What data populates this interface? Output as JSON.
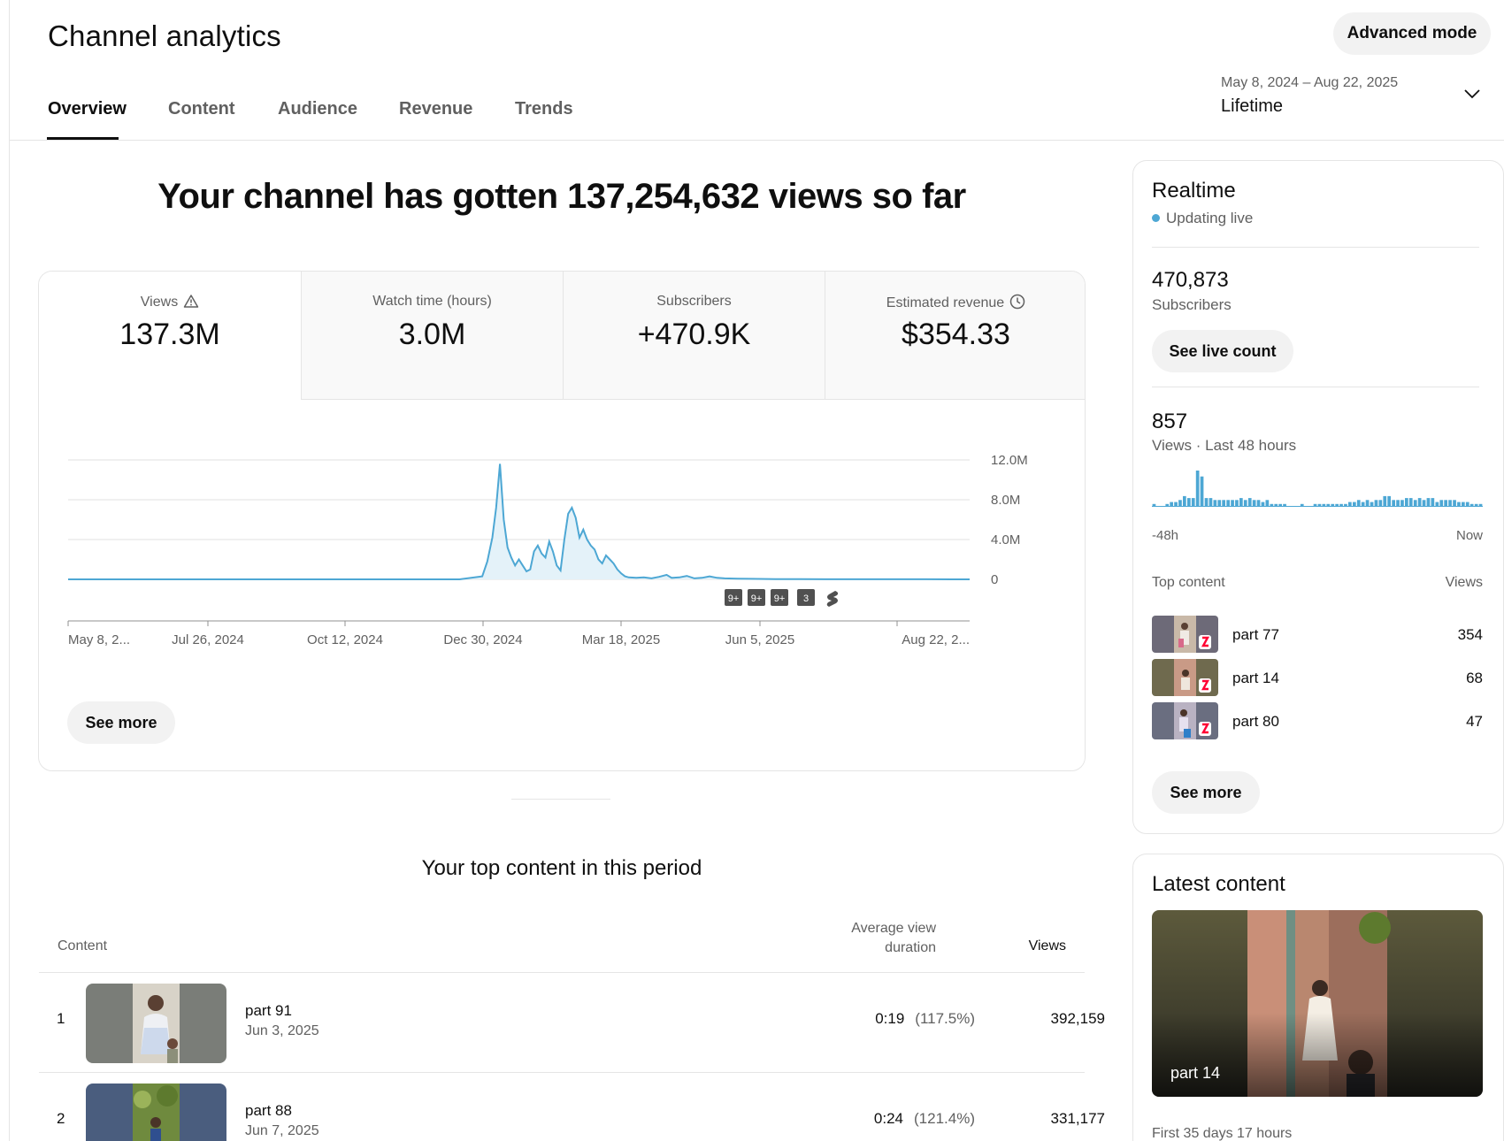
{
  "header": {
    "title": "Channel analytics",
    "advanced_mode_label": "Advanced mode"
  },
  "tabs": [
    {
      "label": "Overview",
      "active": true
    },
    {
      "label": "Content",
      "active": false
    },
    {
      "label": "Audience",
      "active": false
    },
    {
      "label": "Revenue",
      "active": false
    },
    {
      "label": "Trends",
      "active": false
    }
  ],
  "date_range": {
    "dates": "May 8, 2024 – Aug 22, 2025",
    "label": "Lifetime",
    "icon": "chevron-down-icon"
  },
  "headline": "Your channel has gotten 137,254,632 views so far",
  "metrics": [
    {
      "label": "Views",
      "value": "137.3M",
      "icon": "warning-icon",
      "active": true
    },
    {
      "label": "Watch time (hours)",
      "value": "3.0M",
      "active": false
    },
    {
      "label": "Subscribers",
      "value": "+470.9K",
      "active": false
    },
    {
      "label": "Estimated revenue",
      "value": "$354.33",
      "icon": "clock-icon",
      "active": false
    }
  ],
  "chart_data": {
    "type": "area",
    "series": [
      {
        "values": [
          [
            0,
            0
          ],
          [
            310,
            0
          ],
          [
            328,
            0.3
          ],
          [
            332,
            1.8
          ],
          [
            336,
            4.2
          ],
          [
            339,
            7.2
          ],
          [
            342,
            11.6
          ],
          [
            345,
            6.0
          ],
          [
            348,
            3.2
          ],
          [
            351,
            2.2
          ],
          [
            354,
            1.4
          ],
          [
            357,
            2.0
          ],
          [
            360,
            1.4
          ],
          [
            363,
            0.8
          ],
          [
            366,
            1.0
          ],
          [
            369,
            2.8
          ],
          [
            372,
            3.4
          ],
          [
            375,
            2.6
          ],
          [
            378,
            2.2
          ],
          [
            381,
            3.8
          ],
          [
            384,
            2.8
          ],
          [
            387,
            1.4
          ],
          [
            390,
            0.9
          ],
          [
            393,
            4.0
          ],
          [
            396,
            6.6
          ],
          [
            399,
            7.2
          ],
          [
            402,
            6.2
          ],
          [
            405,
            4.2
          ],
          [
            408,
            5.0
          ],
          [
            411,
            4.0
          ],
          [
            414,
            3.4
          ],
          [
            417,
            3.0
          ],
          [
            420,
            2.0
          ],
          [
            423,
            1.6
          ],
          [
            426,
            2.4
          ],
          [
            429,
            2.0
          ],
          [
            432,
            1.6
          ],
          [
            435,
            1.0
          ],
          [
            438,
            0.6
          ],
          [
            441,
            0.3
          ],
          [
            444,
            0.2
          ],
          [
            450,
            0.15
          ],
          [
            456,
            0.2
          ],
          [
            462,
            0.1
          ],
          [
            468,
            0.25
          ],
          [
            474,
            0.45
          ],
          [
            478,
            0.15
          ],
          [
            484,
            0.2
          ],
          [
            490,
            0.35
          ],
          [
            496,
            0.1
          ],
          [
            502,
            0.15
          ],
          [
            508,
            0.3
          ],
          [
            514,
            0.15
          ],
          [
            520,
            0.1
          ],
          [
            530,
            0.06
          ],
          [
            540,
            0.05
          ],
          [
            560,
            0.03
          ],
          [
            580,
            0.02
          ],
          [
            600,
            0.01
          ],
          [
            625,
            0.01
          ],
          [
            640,
            0.01
          ],
          [
            660,
            0.01
          ],
          [
            680,
            0.01
          ],
          [
            700,
            0.0
          ],
          [
            714,
            0.0
          ]
        ]
      }
    ],
    "x_unit": "days since May 8, 2024",
    "x_range": [
      0,
      471
    ],
    "x_tick_labels": [
      "May 8, 2...",
      "Jul 26, 2024",
      "Oct 12, 2024",
      "Dec 30, 2024",
      "Mar 18, 2025",
      "Jun 5, 2025",
      "Aug 22, 2..."
    ],
    "y_tick_labels": [
      "12.0M",
      "8.0M",
      "4.0M",
      "0"
    ],
    "y_ticks": [
      12,
      8,
      4,
      0
    ],
    "ylim": [
      0,
      12
    ],
    "y_unit": "millions of views",
    "markers": [
      "9+",
      "9+",
      "9+",
      "3"
    ],
    "marker_icon": "shorts-icon",
    "color": "#4da7d4"
  },
  "main_see_more": "See more",
  "top_content": {
    "title": "Your top content in this period",
    "col_content": "Content",
    "col_avd": "Average view duration",
    "col_views": "Views",
    "rows": [
      {
        "rank": "1",
        "title": "part 91",
        "date": "Jun 3, 2025",
        "avd": "0:19",
        "avd_pct": "(117.5%)",
        "views": "392,159"
      },
      {
        "rank": "2",
        "title": "part 88",
        "date": "Jun 7, 2025",
        "avd": "0:24",
        "avd_pct": "(121.4%)",
        "views": "331,177"
      }
    ]
  },
  "realtime": {
    "title": "Realtime",
    "live_label": "Updating live",
    "subs_value": "470,873",
    "subs_label": "Subscribers",
    "see_live_count": "See live count",
    "views_value": "857",
    "views_label": "Views · Last 48 hours",
    "axis_start": "-48h",
    "axis_end": "Now",
    "bars": [
      1,
      0,
      0,
      1,
      2,
      2,
      3,
      5,
      4,
      4,
      18,
      15,
      4,
      4,
      3,
      3,
      3,
      3,
      3,
      3,
      4,
      3,
      4,
      3,
      3,
      2,
      3,
      1,
      1,
      1,
      1,
      0,
      0,
      0,
      1,
      0,
      0,
      1,
      1,
      1,
      1,
      1,
      1,
      1,
      1,
      2,
      2,
      3,
      2,
      3,
      2,
      3,
      3,
      5,
      5,
      3,
      3,
      3,
      4,
      4,
      3,
      4,
      3,
      4,
      4,
      2,
      3,
      3,
      3,
      3,
      2,
      2,
      2,
      1,
      1,
      1
    ],
    "bars_color": "#4da7d4",
    "top_content_label": "Top content",
    "views_col_label": "Views",
    "items": [
      {
        "title": "part 77",
        "views": "354"
      },
      {
        "title": "part 14",
        "views": "68"
      },
      {
        "title": "part 80",
        "views": "47"
      }
    ],
    "see_more": "See more"
  },
  "latest": {
    "title": "Latest content",
    "video_title": "part 14",
    "meta": "First 35 days 17 hours"
  }
}
